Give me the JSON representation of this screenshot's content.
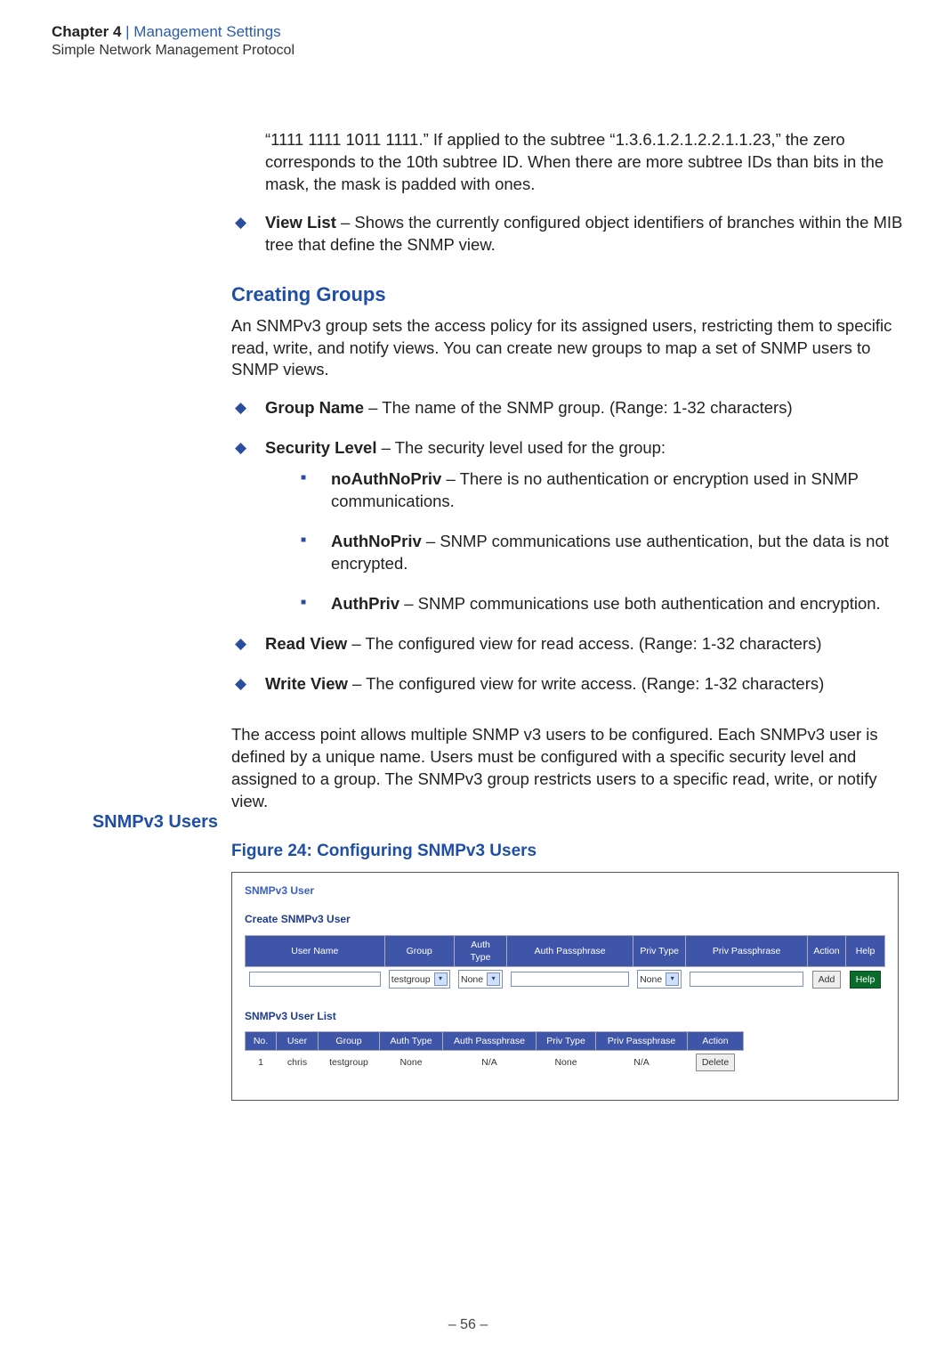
{
  "header": {
    "chapter_label": "Chapter 4",
    "chapter_separator": "  |  ",
    "chapter_title": "Management Settings",
    "section_title": "Simple Network Management Protocol"
  },
  "body": {
    "p1": "“1111 1111 1011 1111.” If applied to the subtree “1.3.6.1.2.1.2.2.1.1.23,” the zero corresponds to the 10th subtree ID. When there are more subtree IDs than bits in the mask, the mask is padded with ones.",
    "view_list_label": "View List",
    "view_list_text": " – Shows the currently configured object identifiers of branches within the MIB tree that define the SNMP view.",
    "creating_groups_heading": "Creating Groups",
    "creating_groups_para": "An SNMPv3 group sets the access policy for its assigned users, restricting them to specific read, write, and notify views. You can create new groups to map a set of SNMP users to SNMP views.",
    "group_name_label": "Group Name",
    "group_name_text": " – The name of the SNMP group. (Range: 1-32 characters)",
    "security_level_label": "Security Level",
    "security_level_text": " – The security level used for the group:",
    "noauth_label": "noAuthNoPriv",
    "noauth_text": " – There is no authentication or encryption used in SNMP communications.",
    "authnopriv_label": "AuthNoPriv",
    "authnopriv_text": " – SNMP communications use authentication, but the data is not encrypted.",
    "authpriv_label": "AuthPriv",
    "authpriv_text": " – SNMP communications use both authentication and encryption.",
    "read_view_label": "Read View",
    "read_view_text": " – The configured view for read access. (Range: 1-32 characters)",
    "write_view_label": "Write View",
    "write_view_text": " – The configured view for write access. (Range: 1-32 characters)",
    "snmpv3_users_side": "SNMPv3 Users",
    "snmpv3_users_para": "The access point allows multiple SNMP v3 users to be configured. Each SNMPv3 user is defined by a unique name. Users must be configured with a specific security level and assigned to a group. The SNMPv3 group restricts users to a specific read, write, or notify view.",
    "figure_caption": "Figure 24:  Configuring SNMPv3 Users"
  },
  "figure": {
    "title1": "SNMPv3 User",
    "title2": "Create SNMPv3 User",
    "title3": "SNMPv3 User List",
    "form_headers": [
      "User Name",
      "Group",
      "Auth Type",
      "Auth Passphrase",
      "Priv Type",
      "Priv Passphrase",
      "Action",
      "Help"
    ],
    "form_row": {
      "group_sel": "testgroup",
      "auth_sel": "None",
      "priv_sel": "None",
      "action_btn": "Add",
      "help_btn": "Help"
    },
    "list_headers": [
      "No.",
      "User",
      "Group",
      "Auth Type",
      "Auth Passphrase",
      "Priv Type",
      "Priv Passphrase",
      "Action"
    ],
    "list_row": {
      "no": "1",
      "user": "chris",
      "group": "testgroup",
      "auth": "None",
      "authpp": "N/A",
      "priv": "None",
      "privpp": "N/A",
      "action_btn": "Delete"
    }
  },
  "footer": {
    "page": "–  56  –"
  }
}
